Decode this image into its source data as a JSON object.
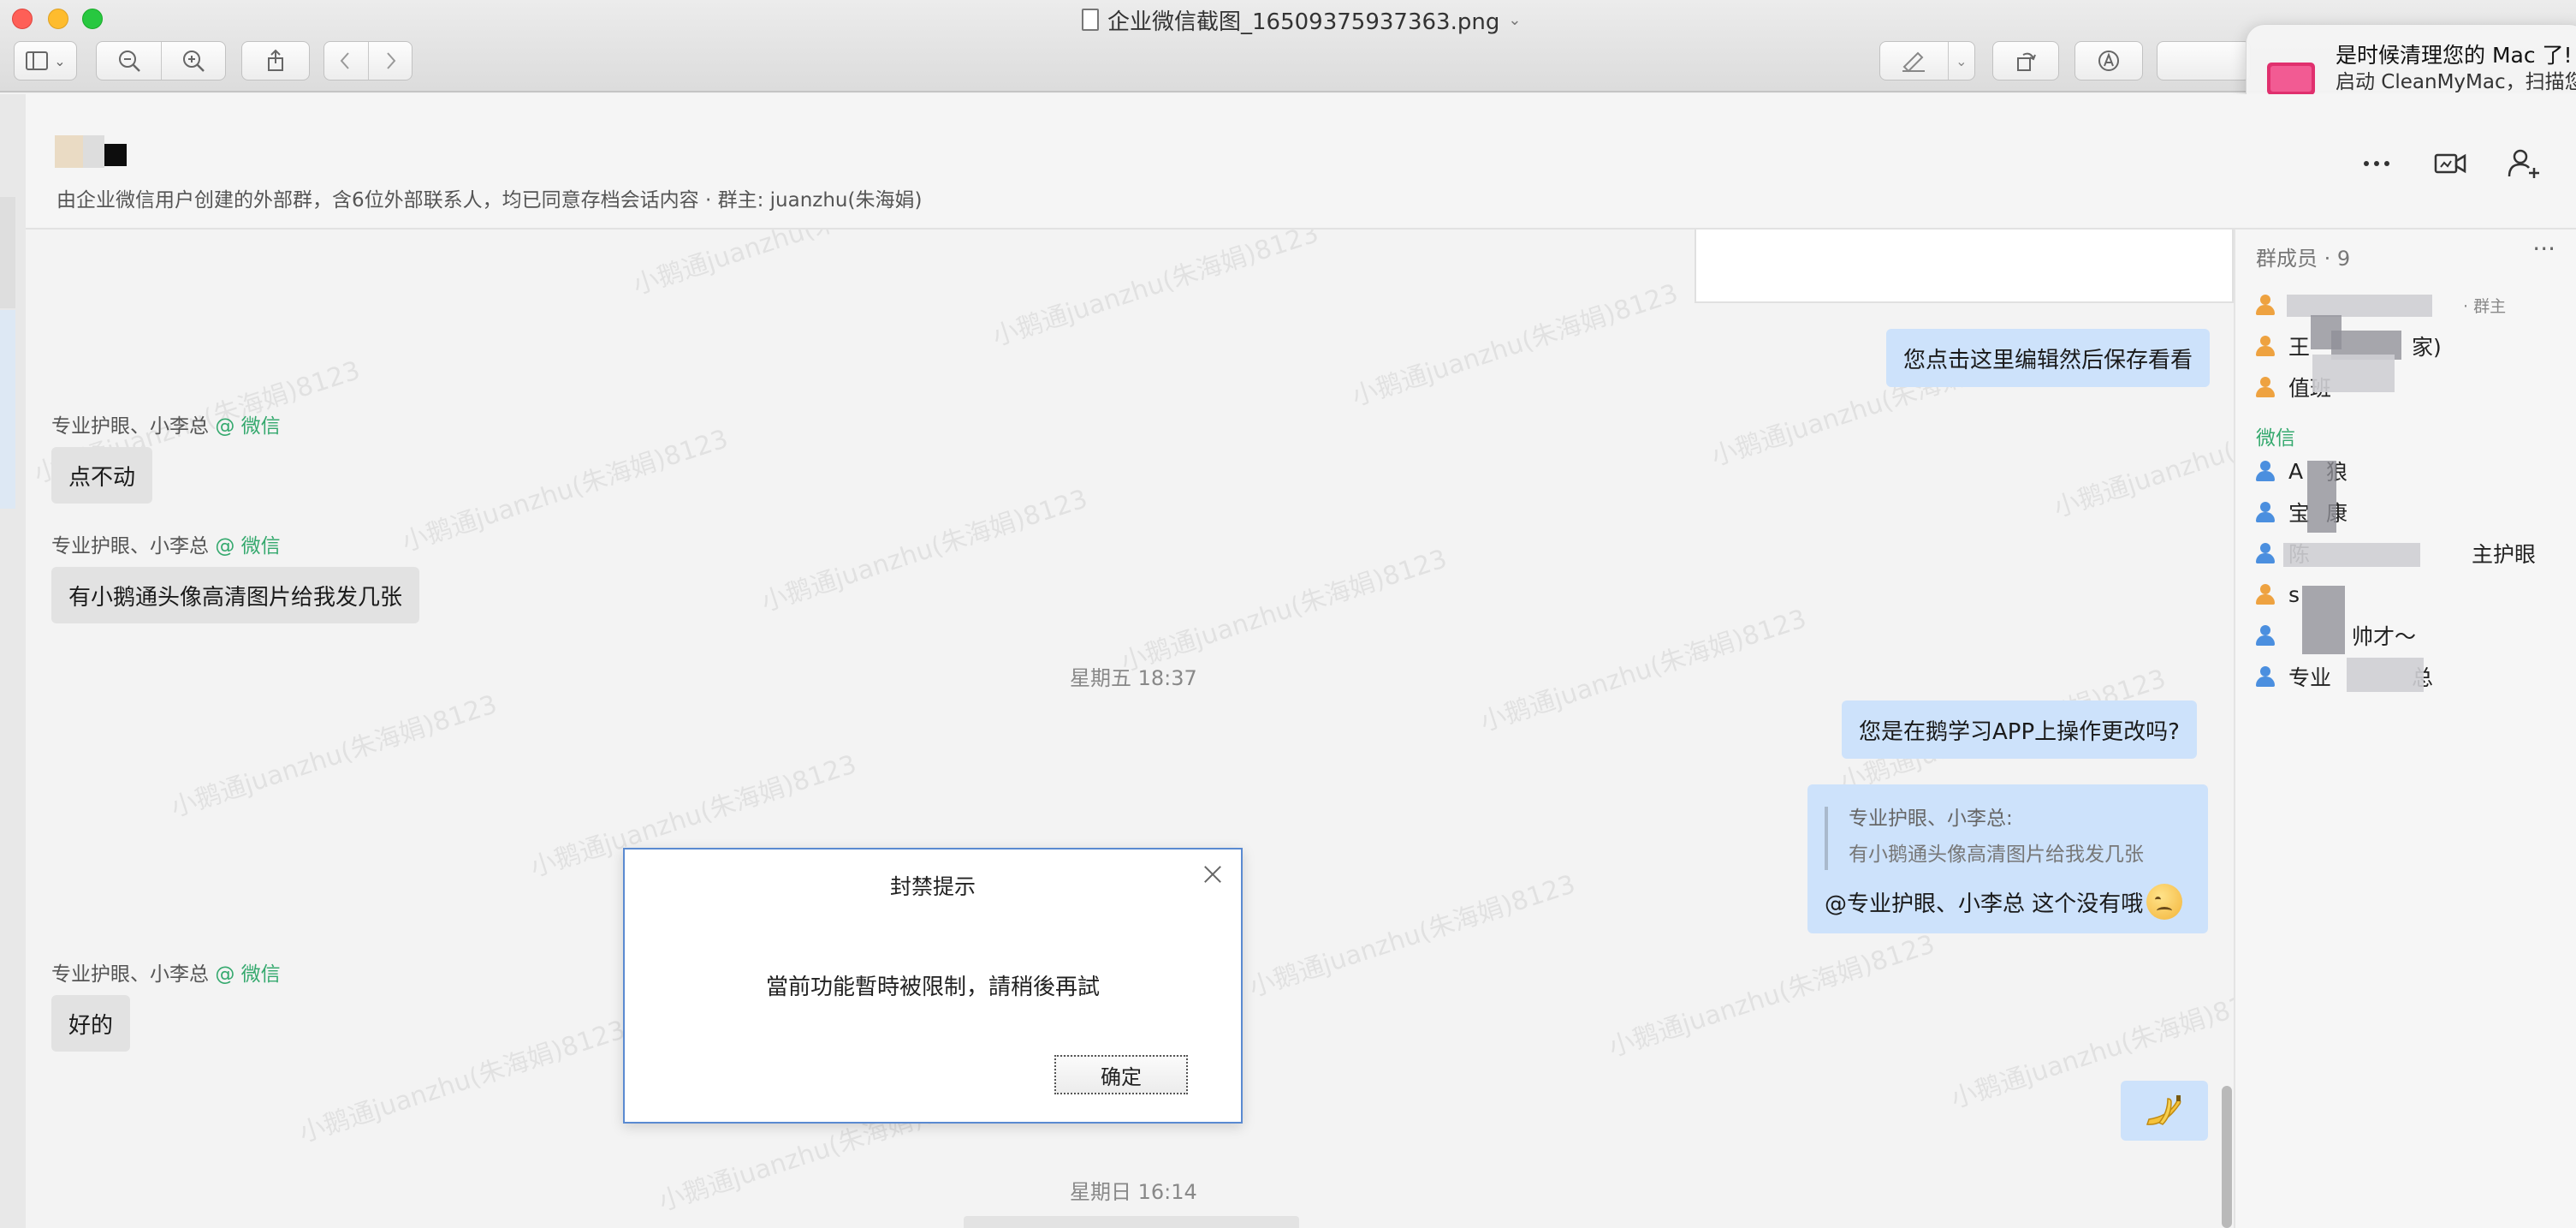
{
  "window": {
    "title": "企业微信截图_16509375937363.png",
    "toolbar": {
      "sidebar_icon": "sidebar-icon",
      "zoom_out_icon": "zoom-out-icon",
      "zoom_in_icon": "zoom-in-icon",
      "share_icon": "share-icon",
      "back_icon": "chevron-left-icon",
      "forward_icon": "chevron-right-icon",
      "markup_pen_icon": "pen-icon",
      "rotate_icon": "rotate-icon",
      "annotate_icon": "markup-icon"
    }
  },
  "notification": {
    "title": "是时候清理您的 Mac 了!",
    "body": "启动 CleanMyMac，扫描您的 垃圾。"
  },
  "chat": {
    "subtitle": "由企业微信用户创建的外部群，含6位外部联系人，均已同意存档会话内容  · 群主: juanzhu(朱海娟)",
    "header_icons": [
      "more-icon",
      "video-icon",
      "add-member-icon"
    ],
    "watermark": "小鹅通juanzhu(朱海娟)8123",
    "messages": {
      "out1": "您点击这里编辑然后保存看看",
      "sender1": "专业护眼、小李总",
      "sender1_tag": "@ 微信",
      "in1": "点不动",
      "sender2": "专业护眼、小李总",
      "sender2_tag": "@ 微信",
      "in2": "有小鹅通头像高清图片给我发几张",
      "time1": "星期五 18:37",
      "out2": "您是在鹅学习APP上操作更改吗?",
      "quote_name": "专业护眼、小李总:",
      "quote_text": "有小鹅通头像高清图片给我发几张",
      "quote_reply": "@专业护眼、小李总  这个没有哦",
      "sender3": "专业护眼、小李总",
      "sender3_tag": "@ 微信",
      "in3": "好的",
      "time2": "星期日 16:14"
    }
  },
  "members": {
    "title": "群成员 · 9",
    "more": "···",
    "owner_tag": "· 群主",
    "group_wechat": "微信",
    "items": [
      {
        "text": "",
        "color": "orange"
      },
      {
        "text": "王",
        "suffix": "家)",
        "color": "orange"
      },
      {
        "text": "值班",
        "color": "orange"
      },
      {
        "text": "A",
        "suffix": "狼",
        "color": "blue"
      },
      {
        "text": "宝",
        "suffix": "康",
        "color": "blue"
      },
      {
        "text": "陈",
        "suffix": "主护眼",
        "color": "blue"
      },
      {
        "text": "s",
        "color": "orange"
      },
      {
        "text": "",
        "suffix": "帅才～",
        "color": "blue"
      },
      {
        "text": "专业",
        "suffix": "总",
        "color": "blue"
      }
    ]
  },
  "dialog": {
    "title": "封禁提示",
    "message": "當前功能暫時被限制，請稍後再試",
    "ok": "确定"
  },
  "colors": {
    "outgoing_bubble": "#cde2fb",
    "incoming_bubble": "#e2e2e2",
    "wechat_tag": "#35a96e",
    "dialog_border": "#5a8ad1"
  }
}
